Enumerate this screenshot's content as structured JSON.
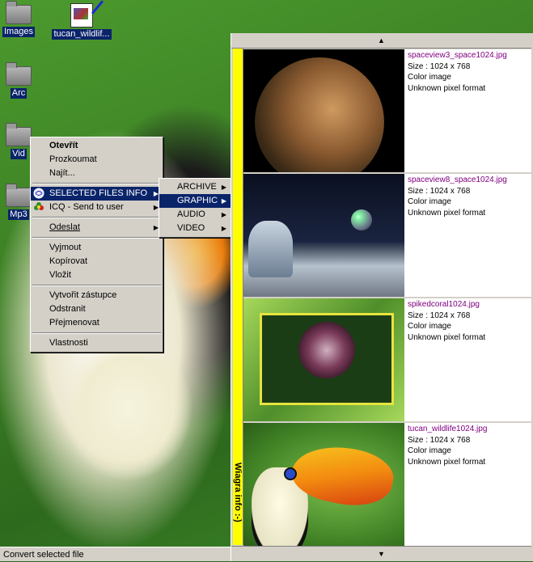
{
  "desktop": {
    "icons": [
      {
        "label": "Images"
      },
      {
        "label": "tucan_wildlif..."
      },
      {
        "label": "Arc"
      },
      {
        "label": "Vid"
      },
      {
        "label": "Mp3"
      }
    ]
  },
  "context_menu": {
    "items": [
      {
        "label": "Otevřít"
      },
      {
        "label": "Prozkoumat"
      },
      {
        "label": "Najít..."
      },
      {
        "label": "SELECTED FILES INFO"
      },
      {
        "label": "ICQ - Send to user"
      },
      {
        "label": "Odeslat"
      },
      {
        "label": "Vyjmout"
      },
      {
        "label": "Kopírovat"
      },
      {
        "label": "Vložit"
      },
      {
        "label": "Vytvořit zástupce"
      },
      {
        "label": "Odstranit"
      },
      {
        "label": "Přejmenovat"
      },
      {
        "label": "Vlastnosti"
      }
    ]
  },
  "submenu": {
    "items": [
      {
        "label": "ARCHIVE"
      },
      {
        "label": "GRAPHIC"
      },
      {
        "label": "AUDIO"
      },
      {
        "label": "VIDEO"
      }
    ]
  },
  "preview": {
    "side_label": "Wiagra info :-)",
    "entries": [
      {
        "file": "spaceview3_space1024.jpg",
        "size": "Size : 1024 x 768",
        "color": "Color image",
        "format": "Unknown pixel format"
      },
      {
        "file": "spaceview8_space1024.jpg",
        "size": "Size : 1024 x 768",
        "color": "Color image",
        "format": "Unknown pixel format"
      },
      {
        "file": "spikedcoral1024.jpg",
        "size": "Size : 1024 x 768",
        "color": "Color image",
        "format": "Unknown pixel format"
      },
      {
        "file": "tucan_wildlife1024.jpg",
        "size": "Size : 1024 x 768",
        "color": "Color image",
        "format": "Unknown pixel format"
      }
    ]
  },
  "status": {
    "text": "Convert selected file"
  },
  "icons": {
    "scroll_up": "triangle-up-icon",
    "scroll_down": "triangle-down-icon",
    "submenu_arrow": "triangle-right-icon"
  }
}
